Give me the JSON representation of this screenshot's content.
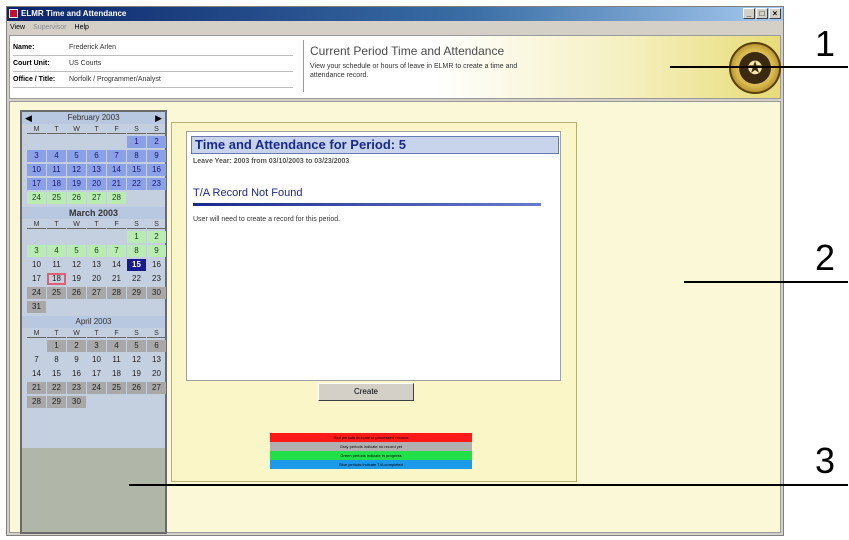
{
  "window": {
    "title": "ELMR Time and Attendance",
    "controls": [
      "_",
      "□",
      "×"
    ]
  },
  "menu": {
    "items": [
      {
        "label": "View",
        "disabled": false
      },
      {
        "label": "Supervisor",
        "disabled": true
      },
      {
        "label": "Help",
        "disabled": false
      }
    ]
  },
  "header": {
    "fields": [
      {
        "label": "Name:",
        "value": "Frederick Arlen"
      },
      {
        "label": "Court Unit:",
        "value": "US Courts"
      },
      {
        "label": "Office / Title:",
        "value": "Norfolk / Programmer/Analyst"
      }
    ],
    "period_title": "Current Period Time and Attendance",
    "period_desc": "View your schedule or hours of leave in ELMR to create a time and attendance record."
  },
  "calendar": {
    "day_headers": [
      "M",
      "T",
      "W",
      "T",
      "F",
      "S",
      "S"
    ],
    "months": [
      {
        "label": "February 2003",
        "bold": false,
        "nav": true,
        "leading_blanks": 5,
        "days": [
          {
            "d": "1",
            "s": "blue"
          },
          {
            "d": "2",
            "s": "blue"
          },
          {
            "d": "3",
            "s": "blue"
          },
          {
            "d": "4",
            "s": "blue"
          },
          {
            "d": "5",
            "s": "blue"
          },
          {
            "d": "6",
            "s": "blue"
          },
          {
            "d": "7",
            "s": "blue"
          },
          {
            "d": "8",
            "s": "blue"
          },
          {
            "d": "9",
            "s": "blue"
          },
          {
            "d": "10",
            "s": "blue"
          },
          {
            "d": "11",
            "s": "blue"
          },
          {
            "d": "12",
            "s": "blue"
          },
          {
            "d": "13",
            "s": "blue"
          },
          {
            "d": "14",
            "s": "blue"
          },
          {
            "d": "15",
            "s": "blue"
          },
          {
            "d": "16",
            "s": "blue"
          },
          {
            "d": "17",
            "s": "blue"
          },
          {
            "d": "18",
            "s": "blue"
          },
          {
            "d": "19",
            "s": "blue"
          },
          {
            "d": "20",
            "s": "blue"
          },
          {
            "d": "21",
            "s": "blue"
          },
          {
            "d": "22",
            "s": "blue"
          },
          {
            "d": "23",
            "s": "blue"
          },
          {
            "d": "24",
            "s": "green"
          },
          {
            "d": "25",
            "s": "green"
          },
          {
            "d": "26",
            "s": "green"
          },
          {
            "d": "27",
            "s": "green"
          },
          {
            "d": "28",
            "s": "green"
          }
        ]
      },
      {
        "label": "March 2003",
        "bold": true,
        "nav": false,
        "leading_blanks": 5,
        "days": [
          {
            "d": "1",
            "s": "green"
          },
          {
            "d": "2",
            "s": "green"
          },
          {
            "d": "3",
            "s": "green"
          },
          {
            "d": "4",
            "s": "green"
          },
          {
            "d": "5",
            "s": "green"
          },
          {
            "d": "6",
            "s": "green"
          },
          {
            "d": "7",
            "s": "green"
          },
          {
            "d": "8",
            "s": "green"
          },
          {
            "d": "9",
            "s": "green"
          },
          {
            "d": "10",
            "s": "plain"
          },
          {
            "d": "11",
            "s": "plain"
          },
          {
            "d": "12",
            "s": "plain"
          },
          {
            "d": "13",
            "s": "plain"
          },
          {
            "d": "14",
            "s": "plain"
          },
          {
            "d": "15",
            "s": "today"
          },
          {
            "d": "16",
            "s": "plain"
          },
          {
            "d": "17",
            "s": "plain"
          },
          {
            "d": "18",
            "s": "selected"
          },
          {
            "d": "19",
            "s": "plain"
          },
          {
            "d": "20",
            "s": "plain"
          },
          {
            "d": "21",
            "s": "plain"
          },
          {
            "d": "22",
            "s": "plain"
          },
          {
            "d": "23",
            "s": "plain"
          },
          {
            "d": "24",
            "s": "gray"
          },
          {
            "d": "25",
            "s": "gray"
          },
          {
            "d": "26",
            "s": "gray"
          },
          {
            "d": "27",
            "s": "gray"
          },
          {
            "d": "28",
            "s": "gray"
          },
          {
            "d": "29",
            "s": "gray"
          },
          {
            "d": "30",
            "s": "gray"
          },
          {
            "d": "31",
            "s": "gray"
          }
        ]
      },
      {
        "label": "April 2003",
        "bold": false,
        "nav": false,
        "leading_blanks": 1,
        "days": [
          {
            "d": "1",
            "s": "gray"
          },
          {
            "d": "2",
            "s": "gray"
          },
          {
            "d": "3",
            "s": "gray"
          },
          {
            "d": "4",
            "s": "gray"
          },
          {
            "d": "5",
            "s": "gray"
          },
          {
            "d": "6",
            "s": "gray"
          },
          {
            "d": "7",
            "s": "plain"
          },
          {
            "d": "8",
            "s": "plain"
          },
          {
            "d": "9",
            "s": "plain"
          },
          {
            "d": "10",
            "s": "plain"
          },
          {
            "d": "11",
            "s": "plain"
          },
          {
            "d": "12",
            "s": "plain"
          },
          {
            "d": "13",
            "s": "plain"
          },
          {
            "d": "14",
            "s": "plain"
          },
          {
            "d": "15",
            "s": "plain"
          },
          {
            "d": "16",
            "s": "plain"
          },
          {
            "d": "17",
            "s": "plain"
          },
          {
            "d": "18",
            "s": "plain"
          },
          {
            "d": "19",
            "s": "plain"
          },
          {
            "d": "20",
            "s": "plain"
          },
          {
            "d": "21",
            "s": "gray"
          },
          {
            "d": "22",
            "s": "gray"
          },
          {
            "d": "23",
            "s": "gray"
          },
          {
            "d": "24",
            "s": "gray"
          },
          {
            "d": "25",
            "s": "gray"
          },
          {
            "d": "26",
            "s": "gray"
          },
          {
            "d": "27",
            "s": "gray"
          },
          {
            "d": "28",
            "s": "gray"
          },
          {
            "d": "29",
            "s": "gray"
          },
          {
            "d": "30",
            "s": "gray"
          }
        ]
      }
    ]
  },
  "record": {
    "title": "Time and Attendance for Period: 5",
    "leave_year": "Leave Year: 2003 from 03/10/2003 to 03/23/2003",
    "status": "T/A Record Not Found",
    "message": "User will need to create a record for this period.",
    "create_label": "Create"
  },
  "legend": [
    {
      "label": "Red periods indicate unprocessed records",
      "color": "#ff1a1a"
    },
    {
      "label": "Gray periods indicate no record yet",
      "color": "#b0b0b0"
    },
    {
      "label": "Green periods indicate in progress",
      "color": "#22e04a"
    },
    {
      "label": "Blue periods indicate T/A completed",
      "color": "#1a9ae8"
    }
  ],
  "callouts": {
    "one": "1",
    "two": "2",
    "three": "3"
  }
}
